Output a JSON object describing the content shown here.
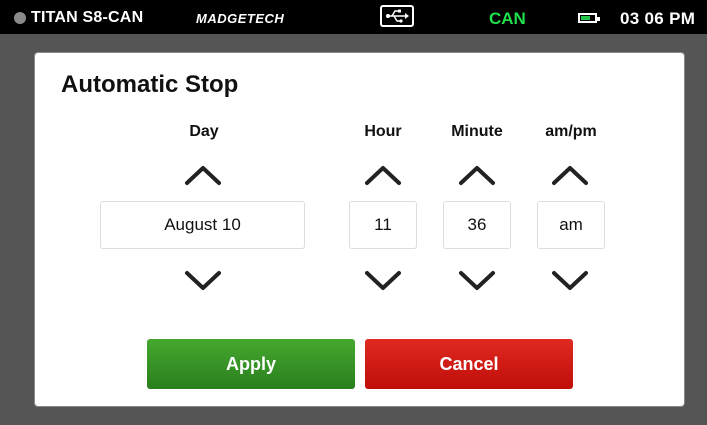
{
  "status": {
    "device": "TITAN S8-CAN",
    "brand": "MADGETECH",
    "mode": "CAN",
    "time": "03 06 PM",
    "battery_level": 0.7,
    "icons": [
      "status-dot",
      "usb-icon",
      "battery-icon"
    ],
    "colors": {
      "mode": "#1ee04a",
      "battery": "#23c64b"
    }
  },
  "dialog": {
    "title": "Automatic Stop",
    "columns": {
      "day": {
        "label": "Day",
        "value": "August 10"
      },
      "hour": {
        "label": "Hour",
        "value": "11"
      },
      "minute": {
        "label": "Minute",
        "value": "36"
      },
      "ampm": {
        "label": "am/pm",
        "value": "am"
      }
    },
    "buttons": {
      "apply": "Apply",
      "cancel": "Cancel"
    },
    "colors": {
      "apply": "#3a9a28",
      "cancel": "#d01a14"
    }
  }
}
